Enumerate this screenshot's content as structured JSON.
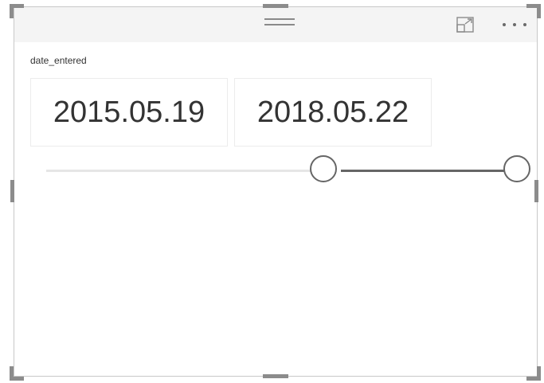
{
  "slicer": {
    "field_name": "date_entered",
    "start_date": "2015.05.19",
    "end_date": "2018.05.22",
    "range_selected": {
      "low_fraction": 0.58,
      "high_fraction": 1.0
    }
  },
  "header": {
    "icons": [
      "drag-handle-icon",
      "focus-mode-icon",
      "more-options-icon"
    ]
  },
  "colors": {
    "track": "#e6e6e6",
    "range": "#666666",
    "handle_border": "#666666",
    "selection_handles": "#8c8c8c"
  }
}
